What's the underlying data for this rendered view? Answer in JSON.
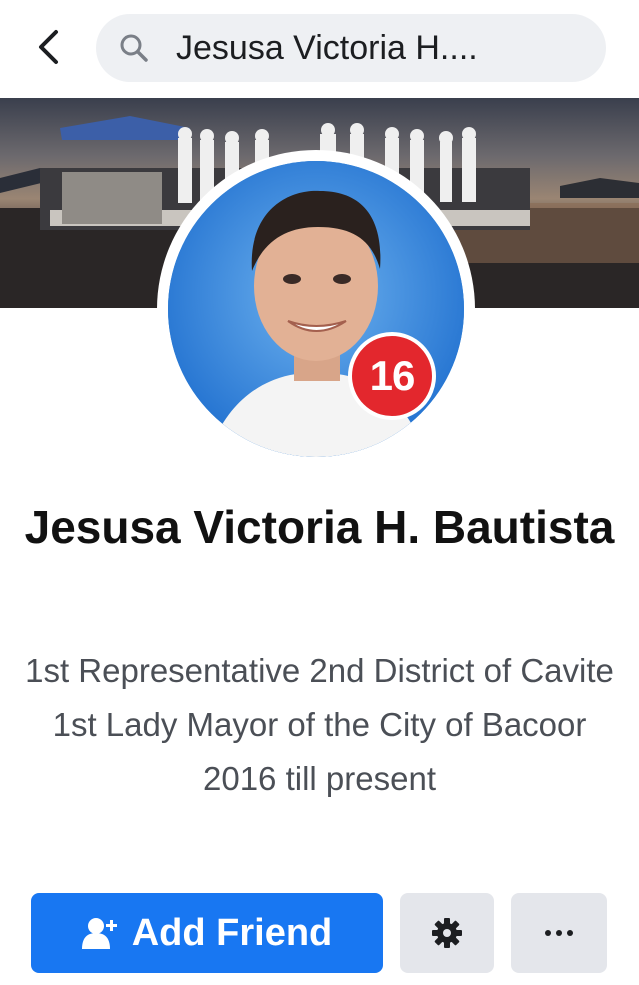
{
  "search": {
    "query": "Jesusa Victoria H...."
  },
  "profile": {
    "name": "Jesusa Victoria H. Bautista",
    "badge_number": "16",
    "bio_line1": "1st Representative 2nd District of Cavite",
    "bio_line2": "1st Lady Mayor of the City of Bacoor 2016 till present"
  },
  "actions": {
    "add_friend_label": "Add Friend"
  },
  "colors": {
    "primary_button": "#1877f2",
    "secondary_button": "#e4e6eb",
    "badge": "#e3272d",
    "search_bg": "#eef0f3"
  },
  "icons": {
    "back": "chevron-left-icon",
    "search": "search-icon",
    "add_friend": "add-person-icon",
    "settings": "gear-icon",
    "more": "more-dots-icon"
  }
}
